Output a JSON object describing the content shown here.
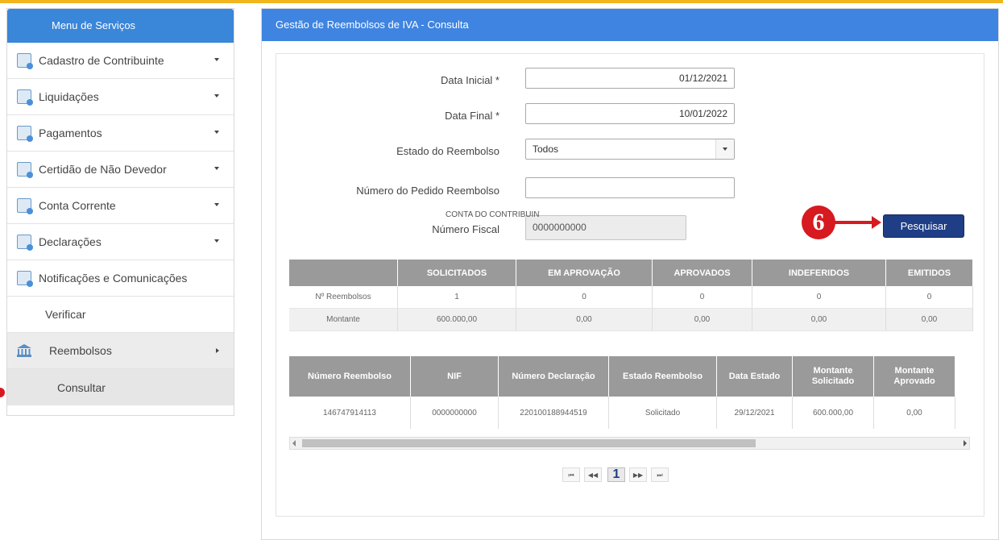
{
  "sidebar": {
    "title": "Menu de Serviços",
    "items": [
      {
        "label": "Cadastro de Contribuinte",
        "icon": "registry-icon"
      },
      {
        "label": "Liquidações",
        "icon": "settlement-icon"
      },
      {
        "label": "Pagamentos",
        "icon": "payments-icon"
      },
      {
        "label": "Certidão de Não Devedor",
        "icon": "certificate-icon"
      },
      {
        "label": "Conta Corrente",
        "icon": "account-icon"
      },
      {
        "label": "Declarações",
        "icon": "declarations-icon"
      },
      {
        "label": "Notificações e Comunicações",
        "icon": "notifications-icon"
      },
      {
        "label": "Verificar"
      },
      {
        "label": "Reembolsos",
        "icon": "bank-icon"
      },
      {
        "label": "Consultar"
      }
    ]
  },
  "panel": {
    "title": "Gestão de Reembolsos de IVA - Consulta"
  },
  "form": {
    "data_inicial_label": "Data Inicial *",
    "data_inicial_value": "01/12/2021",
    "data_final_label": "Data Final *",
    "data_final_value": "10/01/2022",
    "estado_label": "Estado do Reembolso",
    "estado_value": "Todos",
    "numero_pedido_label": "Número do Pedido Reembolso",
    "numero_pedido_value": "",
    "numero_fiscal_label": "Número Fiscal",
    "numero_fiscal_value": "0000000000",
    "conta_label": "CONTA DO CONTRIBUINTE",
    "search_button": "Pesquisar"
  },
  "annotation": {
    "step_number": "6",
    "color": "#d71920"
  },
  "summary": {
    "headers": [
      "",
      "SOLICITADOS",
      "EM APROVAÇÃO",
      "APROVADOS",
      "INDEFERIDOS",
      "EMITIDOS"
    ],
    "rows": [
      [
        "Nº Reembolsos",
        "1",
        "0",
        "0",
        "0",
        "0"
      ],
      [
        "Montante",
        "600.000,00",
        "0,00",
        "0,00",
        "0,00",
        "0,00"
      ]
    ]
  },
  "results": {
    "headers": [
      "Número Reembolso",
      "NIF",
      "Número Declaração",
      "Estado Reembolso",
      "Data Estado",
      "Montante Solicitado",
      "Montante Aprovado"
    ],
    "rows": [
      [
        "146747914113",
        "0000000000",
        "220100188944519",
        "Solicitado",
        "29/12/2021",
        "600.000,00",
        "0,00"
      ]
    ]
  },
  "pagination": {
    "first": "⏮",
    "prev": "◀◀",
    "current": "1",
    "next": "▶▶",
    "last": "⏭"
  },
  "colors": {
    "header_blue": "#3f84e0",
    "button_navy": "#1f3e86",
    "top_bar": "#f2b51d"
  }
}
